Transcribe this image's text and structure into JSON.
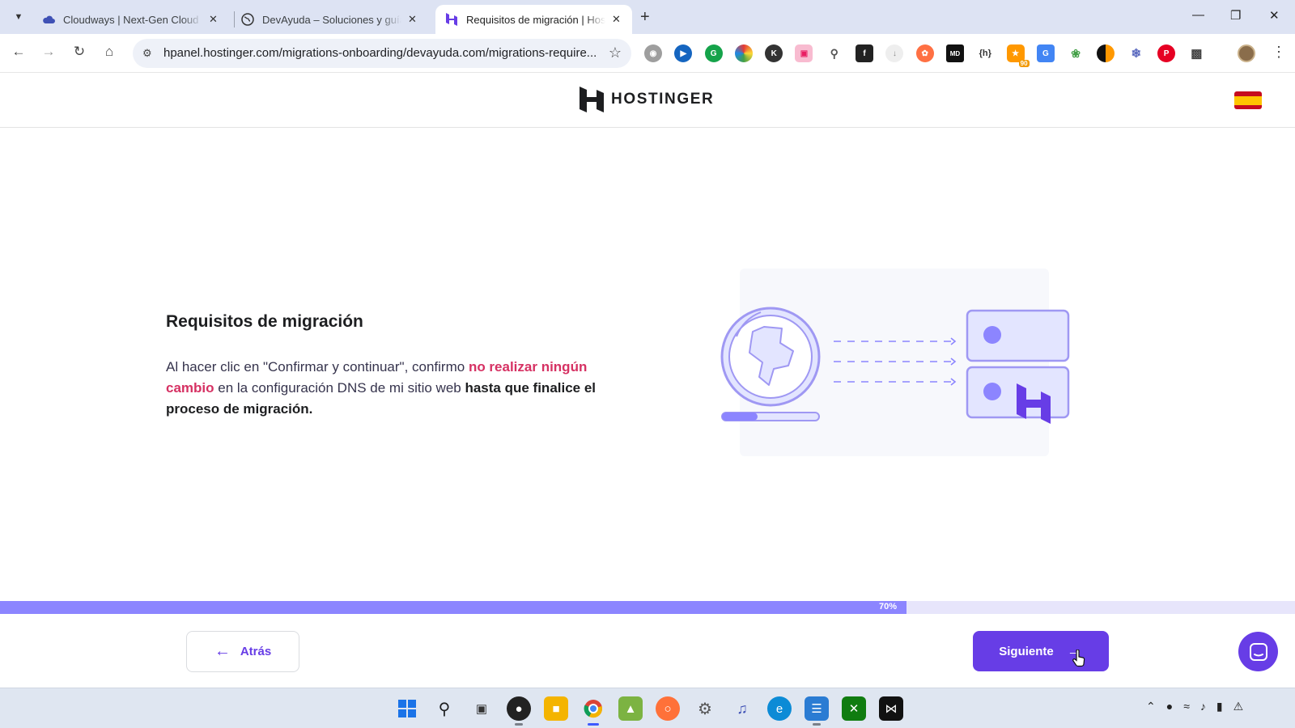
{
  "browser": {
    "tabs": [
      {
        "title": "Cloudways | Next-Gen Cloud H",
        "favicon": "cloud-icon",
        "active": false
      },
      {
        "title": "DevAyuda – Soluciones y guías",
        "favicon": "globe-icon",
        "active": false
      },
      {
        "title": "Requisitos de migración | Hosti",
        "favicon": "hostinger-icon",
        "active": true
      }
    ],
    "url": "hpanel.hostinger.com/migrations-onboarding/devayuda.com/migrations-require...",
    "extension_icons": [
      "camera-icon",
      "play-circle-icon",
      "grammarly-icon",
      "color-wheel-icon",
      "k-icon",
      "square-icon",
      "magnifier-icon",
      "f-icon",
      "download-icon",
      "paw-icon",
      "md-icon",
      "bracket-h-icon",
      "counter-icon",
      "translate-icon",
      "leaf-icon",
      "half-circle-icon",
      "snowflake-icon",
      "pinterest-icon",
      "puzzle-icon"
    ],
    "extension_badge": "90"
  },
  "header": {
    "brand": "HOSTINGER",
    "language_flag": "es"
  },
  "content": {
    "title": "Requisitos de migración",
    "desc_part1": "Al hacer clic en \"Confirmar y continuar\", confirmo ",
    "desc_highlight": "no realizar ningún cambio",
    "desc_part2": " en la configuración DNS de mi sitio web ",
    "desc_bold": "hasta que finalice el proceso de migración."
  },
  "progress": {
    "percent": 70,
    "label": "70%"
  },
  "footer": {
    "back_label": "Atrás",
    "next_label": "Siguiente"
  },
  "colors": {
    "primary": "#673de6",
    "highlight": "#d63163",
    "progress_fill": "#8c85ff",
    "progress_track": "#e7e5fb"
  }
}
